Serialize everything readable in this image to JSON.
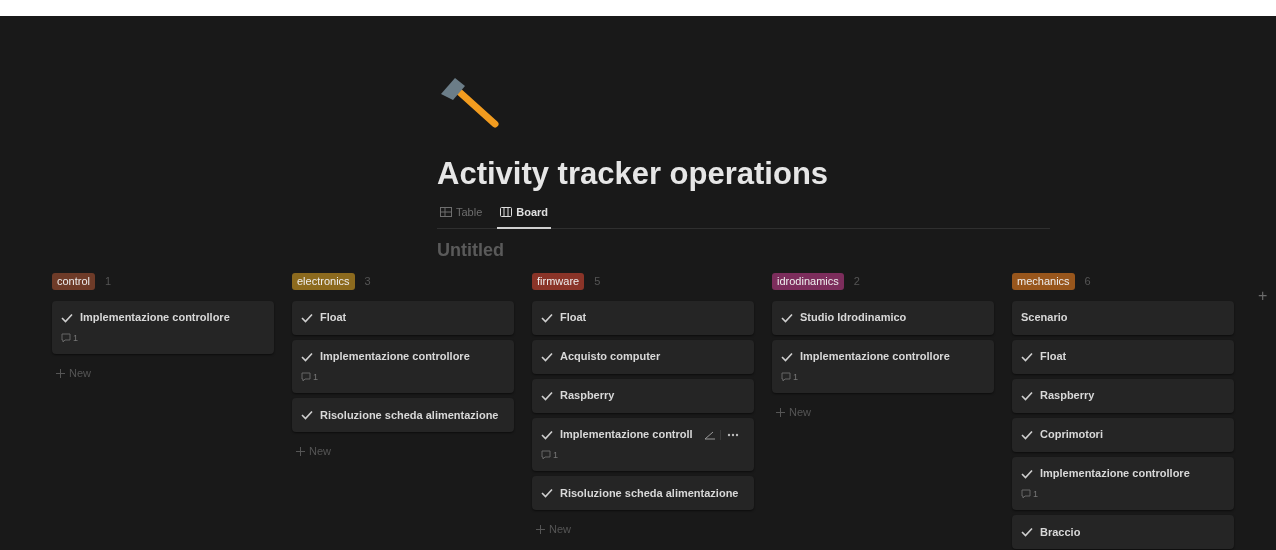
{
  "page": {
    "title": "Activity tracker operations",
    "subtitle": "Untitled"
  },
  "views": [
    {
      "label": "Table",
      "kind": "table",
      "selected": false
    },
    {
      "label": "Board",
      "kind": "board",
      "selected": true
    }
  ],
  "groups": [
    {
      "label": "control",
      "count": "1",
      "color": "#6e3b28",
      "new_label": "New",
      "cards": [
        {
          "title": "Implementazione controllore",
          "done": true,
          "comments": "1",
          "hovered": false
        }
      ]
    },
    {
      "label": "electronics",
      "count": "3",
      "color": "#8c6a1e",
      "new_label": "New",
      "cards": [
        {
          "title": "Float",
          "done": true,
          "hovered": false
        },
        {
          "title": "Implementazione controllore",
          "done": true,
          "comments": "1",
          "hovered": false
        },
        {
          "title": "Risoluzione scheda alimentazione",
          "done": true,
          "hovered": false
        }
      ]
    },
    {
      "label": "firmware",
      "count": "5",
      "color": "#8a3428",
      "new_label": "New",
      "cards": [
        {
          "title": "Float",
          "done": true,
          "hovered": false
        },
        {
          "title": "Acquisto computer",
          "done": true,
          "hovered": false
        },
        {
          "title": "Raspberry",
          "done": true,
          "hovered": false
        },
        {
          "title": "Implementazione controll",
          "done": true,
          "comments": "1",
          "hovered": true
        },
        {
          "title": "Risoluzione scheda alimentazione",
          "done": true,
          "hovered": false
        }
      ]
    },
    {
      "label": "idrodinamics",
      "count": "2",
      "color": "#7c2d5c",
      "new_label": "New",
      "cards": [
        {
          "title": "Studio Idrodinamico",
          "done": true,
          "hovered": false
        },
        {
          "title": "Implementazione controllore",
          "done": true,
          "comments": "1",
          "hovered": false
        }
      ]
    },
    {
      "label": "mechanics",
      "count": "6",
      "color": "#98561c",
      "cards": [
        {
          "title": "Scenario",
          "done": false,
          "hovered": false
        },
        {
          "title": "Float",
          "done": true,
          "hovered": false
        },
        {
          "title": "Raspberry",
          "done": true,
          "hovered": false
        },
        {
          "title": "Coprimotori",
          "done": true,
          "hovered": false
        },
        {
          "title": "Implementazione controllore",
          "done": true,
          "comments": "1",
          "hovered": false
        },
        {
          "title": "Braccio",
          "done": true,
          "hovered": false
        }
      ]
    }
  ],
  "add_group": "+"
}
